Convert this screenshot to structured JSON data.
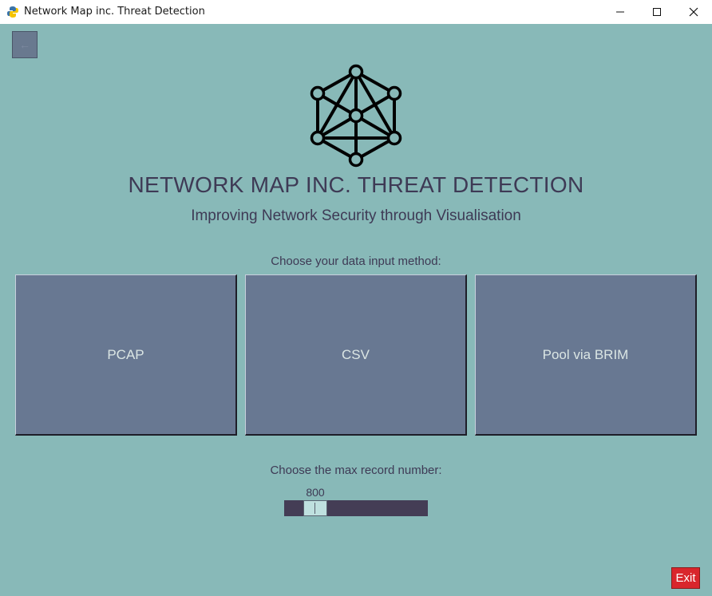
{
  "window": {
    "title": "Network Map inc. Threat Detection",
    "controls": [
      "minimize-icon",
      "maximize-icon",
      "close-icon"
    ]
  },
  "header": {
    "back_label": "←",
    "logo_icon": "network-graph-icon",
    "title": "NETWORK MAP INC. THREAT DETECTION",
    "subtitle": "Improving Network Security through Visualisation"
  },
  "input_method": {
    "label": "Choose your data input method:",
    "options": [
      {
        "label": "PCAP"
      },
      {
        "label": "CSV"
      },
      {
        "label": "Pool via BRIM"
      }
    ]
  },
  "record_limit": {
    "label": "Choose the max record number:",
    "value": "800"
  },
  "footer": {
    "exit_label": "Exit"
  },
  "colors": {
    "background": "#88b9b8",
    "button": "#687892",
    "text": "#3e3a55",
    "slider_track": "#443d55",
    "exit": "#d9262c"
  }
}
